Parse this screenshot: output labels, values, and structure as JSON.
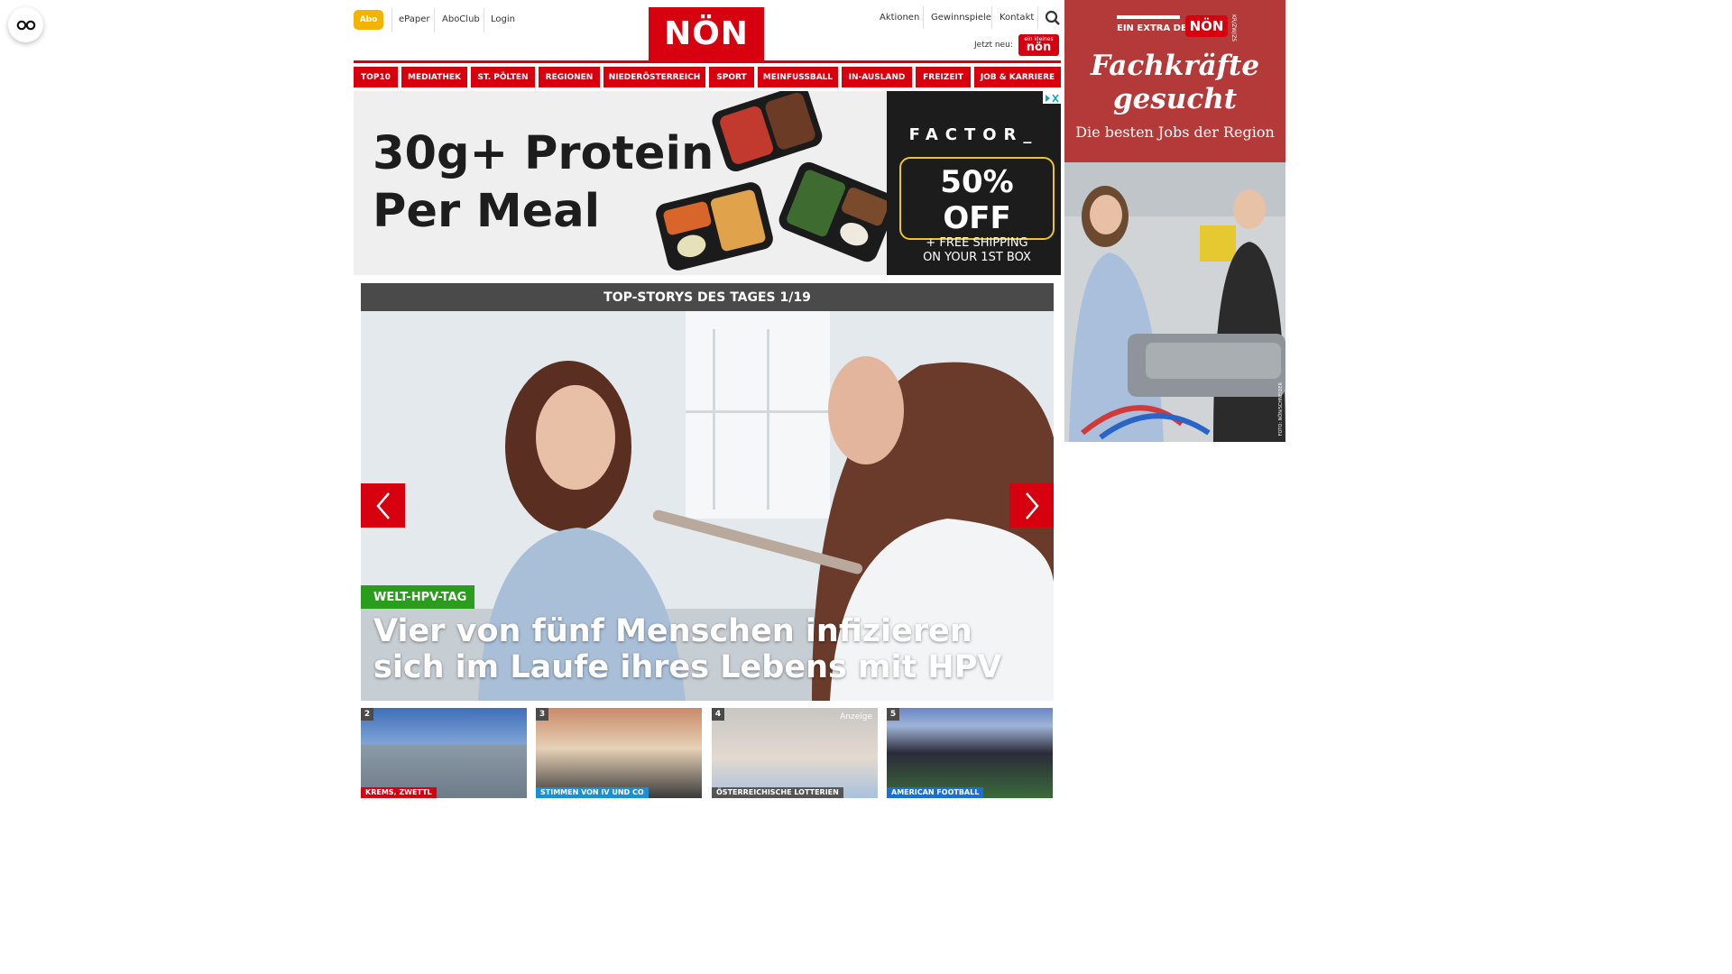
{
  "header": {
    "abo": "Abo",
    "links_left": [
      "ePaper",
      "AboClub",
      "Login"
    ],
    "logo": "NÖN",
    "links_right": [
      "Aktionen",
      "Gewinnspiele",
      "Kontakt"
    ],
    "jetzt_neu": "Jetzt neu:",
    "jetzt_logo_small": "ein kleines",
    "jetzt_logo": "nön"
  },
  "nav": [
    "TOP10",
    "MEDIATHEK",
    "ST. PÖLTEN",
    "REGIONEN",
    "NIEDERÖSTERREICH",
    "SPORT",
    "MEINFUSSBALL",
    "IN-AUSLAND",
    "FREIZEIT",
    "JOB & KARRIERE"
  ],
  "banner_ad": {
    "headline_1": "30g+ Protein",
    "headline_2": "Per Meal",
    "brand": "FACTOR_",
    "offer_big": "50% OFF",
    "offer_small_1": "+ FREE SHIPPING",
    "offer_small_2": "ON YOUR 1ST BOX"
  },
  "top_stories": {
    "bar_title": "TOP-STORYS DES TAGES 1/19",
    "tag": "WELT-HPV-TAG",
    "title": "Vier von fünf Menschen infizieren sich im Laufe ihres Lebens mit HPV"
  },
  "thumbs": [
    {
      "num": "2",
      "tag": "KREMS, ZWETTL",
      "tag_color": "#d6000f"
    },
    {
      "num": "3",
      "tag": "STIMMEN VON IV UND CO",
      "tag_color": "#1a8fd6"
    },
    {
      "num": "4",
      "tag": "ÖSTERREICHISCHE LOTTERIEN",
      "tag_color": "#555555",
      "anzeige": "Anzeige"
    },
    {
      "num": "5",
      "tag": "AMERICAN FOOTBALL",
      "tag_color": "#1a6fd6"
    }
  ],
  "side_ad": {
    "extra": "EIN EXTRA DER",
    "non": "NÖN",
    "kr": "KR/ZW/ZS",
    "title_1": "Fachkräfte",
    "title_2": "gesucht",
    "sub": "Die besten Jobs der Region",
    "credit": "FOTO: NÖN/SCHNEIDER"
  },
  "colors": {
    "brand_red": "#d6000f",
    "abo_yellow": "#f2b400",
    "tag_green": "#2a9d1c",
    "side_ad_bg": "#b33a39"
  }
}
